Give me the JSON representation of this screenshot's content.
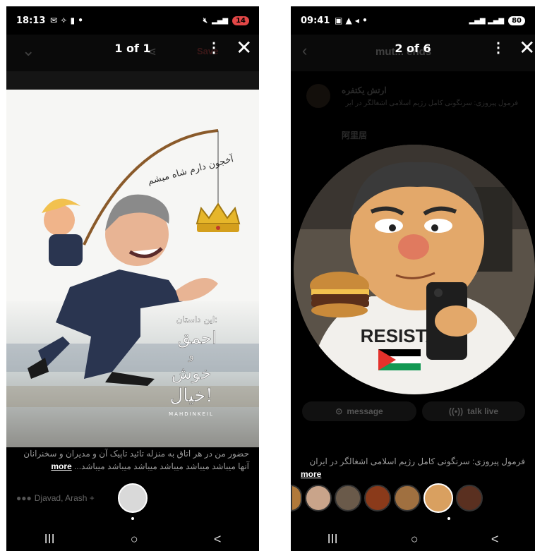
{
  "left": {
    "status_time": "18:13",
    "status_icons": "✉ ✧ ▮ •",
    "battery": "14",
    "counter": "1 of 1",
    "bg_save_label": "Save",
    "caption_text": "حضور من در هر اتاق به منزله تائید تاپیک آن و مدیران و سخنرانان آنها میباشد میباشد میباشد میباشد میباشد میباشد...",
    "more_label": "more",
    "reactions_text": "Djavad, Arash +",
    "artwork": {
      "speech_bubble": "آخجون دارم شاه میشم",
      "story_line1": "این داستان:",
      "story_line2": "احمق",
      "story_line3": "و",
      "story_line4": "خوش",
      "story_line5": "خیال!",
      "signature": "MAHDINKEIL"
    }
  },
  "right": {
    "status_time": "09:41",
    "status_icons": "▣ ▲ ◂ •",
    "battery": "80",
    "counter": "2 of 6",
    "bg_title": "mut... ends",
    "bg_user1": "ارتش يكتفره",
    "bg_user1_sub": "فرمول پیروزی: سرنگونی کامل رژیم اسلامی اشغالگر در ایر",
    "bg_user2": "阿里居",
    "shirt_text": "RESISTA",
    "message_label": "message",
    "talk_live_label": "talk live",
    "caption_text": "فرمول پیروزی: سرنگونی کامل رژیم اسلامی اشغالگر در ایران",
    "more_label": "more"
  },
  "nav": {
    "recents": "III",
    "home": "○",
    "back": "<"
  },
  "colors": {
    "battery_low": "#e24747",
    "crown": "#e6b62a",
    "suit": "#2a3550"
  }
}
